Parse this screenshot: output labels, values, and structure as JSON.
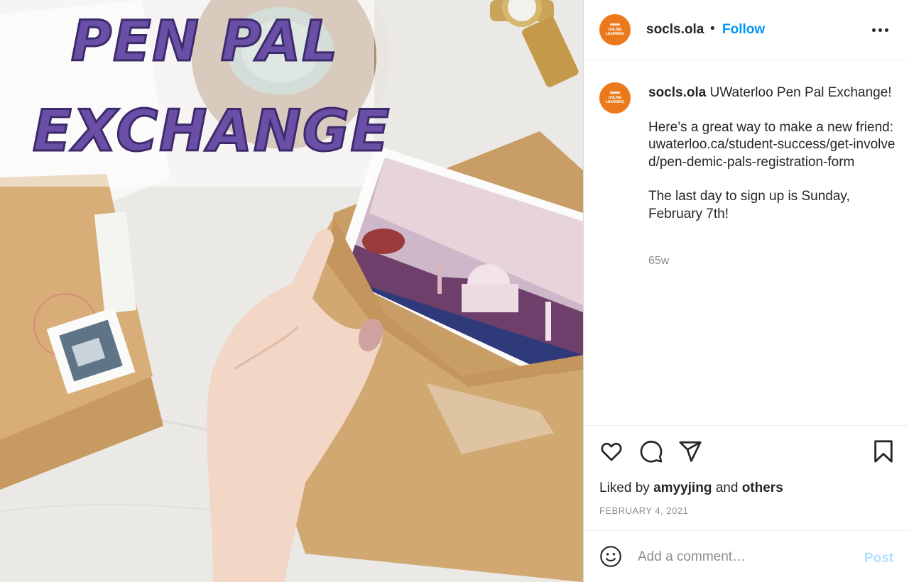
{
  "post_image": {
    "title_line1": "PEN PAL",
    "title_line2": "EXCHANGE"
  },
  "header": {
    "avatar_line1": "ONLINE",
    "avatar_line2": "LEARNING",
    "username": "socls.ola",
    "separator": "•",
    "follow_label": "Follow",
    "more_icon": "more-horizontal-icon"
  },
  "caption": {
    "username": "socls.ola",
    "line1": "UWaterloo Pen Pal Exchange!",
    "para2": "Here’s a great way to make a new friend: uwaterloo.ca/student-success/get-involved/pen-demic-pals-registration-form",
    "para3": "The last day to sign up is Sunday, February 7th!",
    "time_ago": "65w"
  },
  "actions": {
    "icons": [
      "heart-icon",
      "comment-icon",
      "share-icon",
      "bookmark-icon"
    ],
    "liked_by_prefix": "Liked by",
    "liked_by_user": "amyyjing",
    "liked_by_and": "and",
    "liked_by_others": "others",
    "date": "FEBRUARY 4, 2021"
  },
  "comment": {
    "placeholder": "Add a comment…",
    "post_label": "Post"
  },
  "colors": {
    "accent_blue": "#0095f6",
    "post_disabled": "#b2dffc",
    "avatar_orange": "#ec7a1c",
    "title_purple": "#6a4fa6"
  }
}
